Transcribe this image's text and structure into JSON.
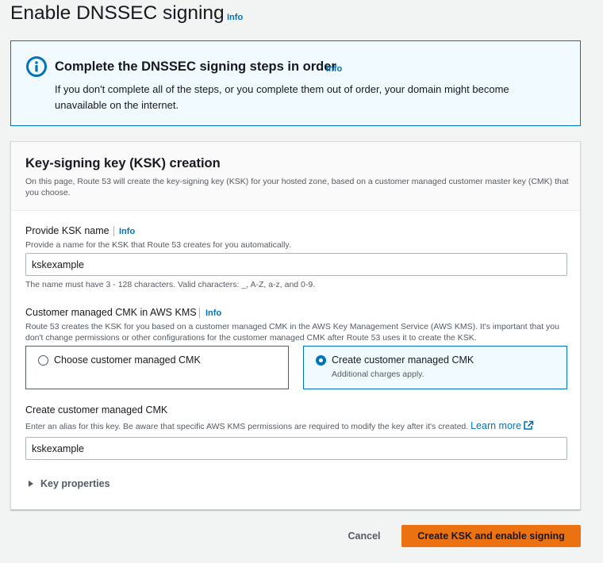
{
  "page": {
    "title": "Enable DNSSEC signing",
    "info_label": "Info"
  },
  "alert": {
    "icon": "info-circle-icon",
    "title": "Complete the DNSSEC signing steps in order",
    "info_label": "Info",
    "body": "If you don't complete all of the steps, or you complete them out of order, your domain might become unavailable on the internet."
  },
  "ksk_section": {
    "title": "Key-signing key (KSK) creation",
    "description": "On this page, Route 53 will create the key-signing key (KSK) for your hosted zone, based on a customer managed customer master key (CMK) that you choose."
  },
  "ksk_name": {
    "label": "Provide KSK name",
    "info_label": "Info",
    "description": "Provide a name for the KSK that Route 53 creates for you automatically.",
    "value": "kskexample",
    "constraint": "The name must have 3 - 128 characters. Valid characters: _, A-Z, a-z, and 0-9."
  },
  "cmk": {
    "label": "Customer managed CMK in AWS KMS",
    "info_label": "Info",
    "description": "Route 53 creates the KSK for you based on a customer managed CMK in the AWS Key Management Service (AWS KMS). It's important that you don't change permissions or other configurations for the customer managed CMK after Route 53 uses it to create the KSK.",
    "options": [
      {
        "label": "Choose customer managed CMK",
        "sublabel": "",
        "selected": false
      },
      {
        "label": "Create customer managed CMK",
        "sublabel": "Additional charges apply.",
        "selected": true
      }
    ]
  },
  "create_cmk": {
    "label": "Create customer managed CMK",
    "description": "Enter an alias for this key. Be aware that specific AWS KMS permissions are required to modify the key after it's created.",
    "learn_more": "Learn more",
    "value": "kskexample"
  },
  "key_properties": {
    "label": "Key properties"
  },
  "actions": {
    "cancel": "Cancel",
    "submit": "Create KSK and enable signing"
  },
  "colors": {
    "link": "#0073bb",
    "primary_button": "#ec7211",
    "alert_background": "#f1faff"
  }
}
